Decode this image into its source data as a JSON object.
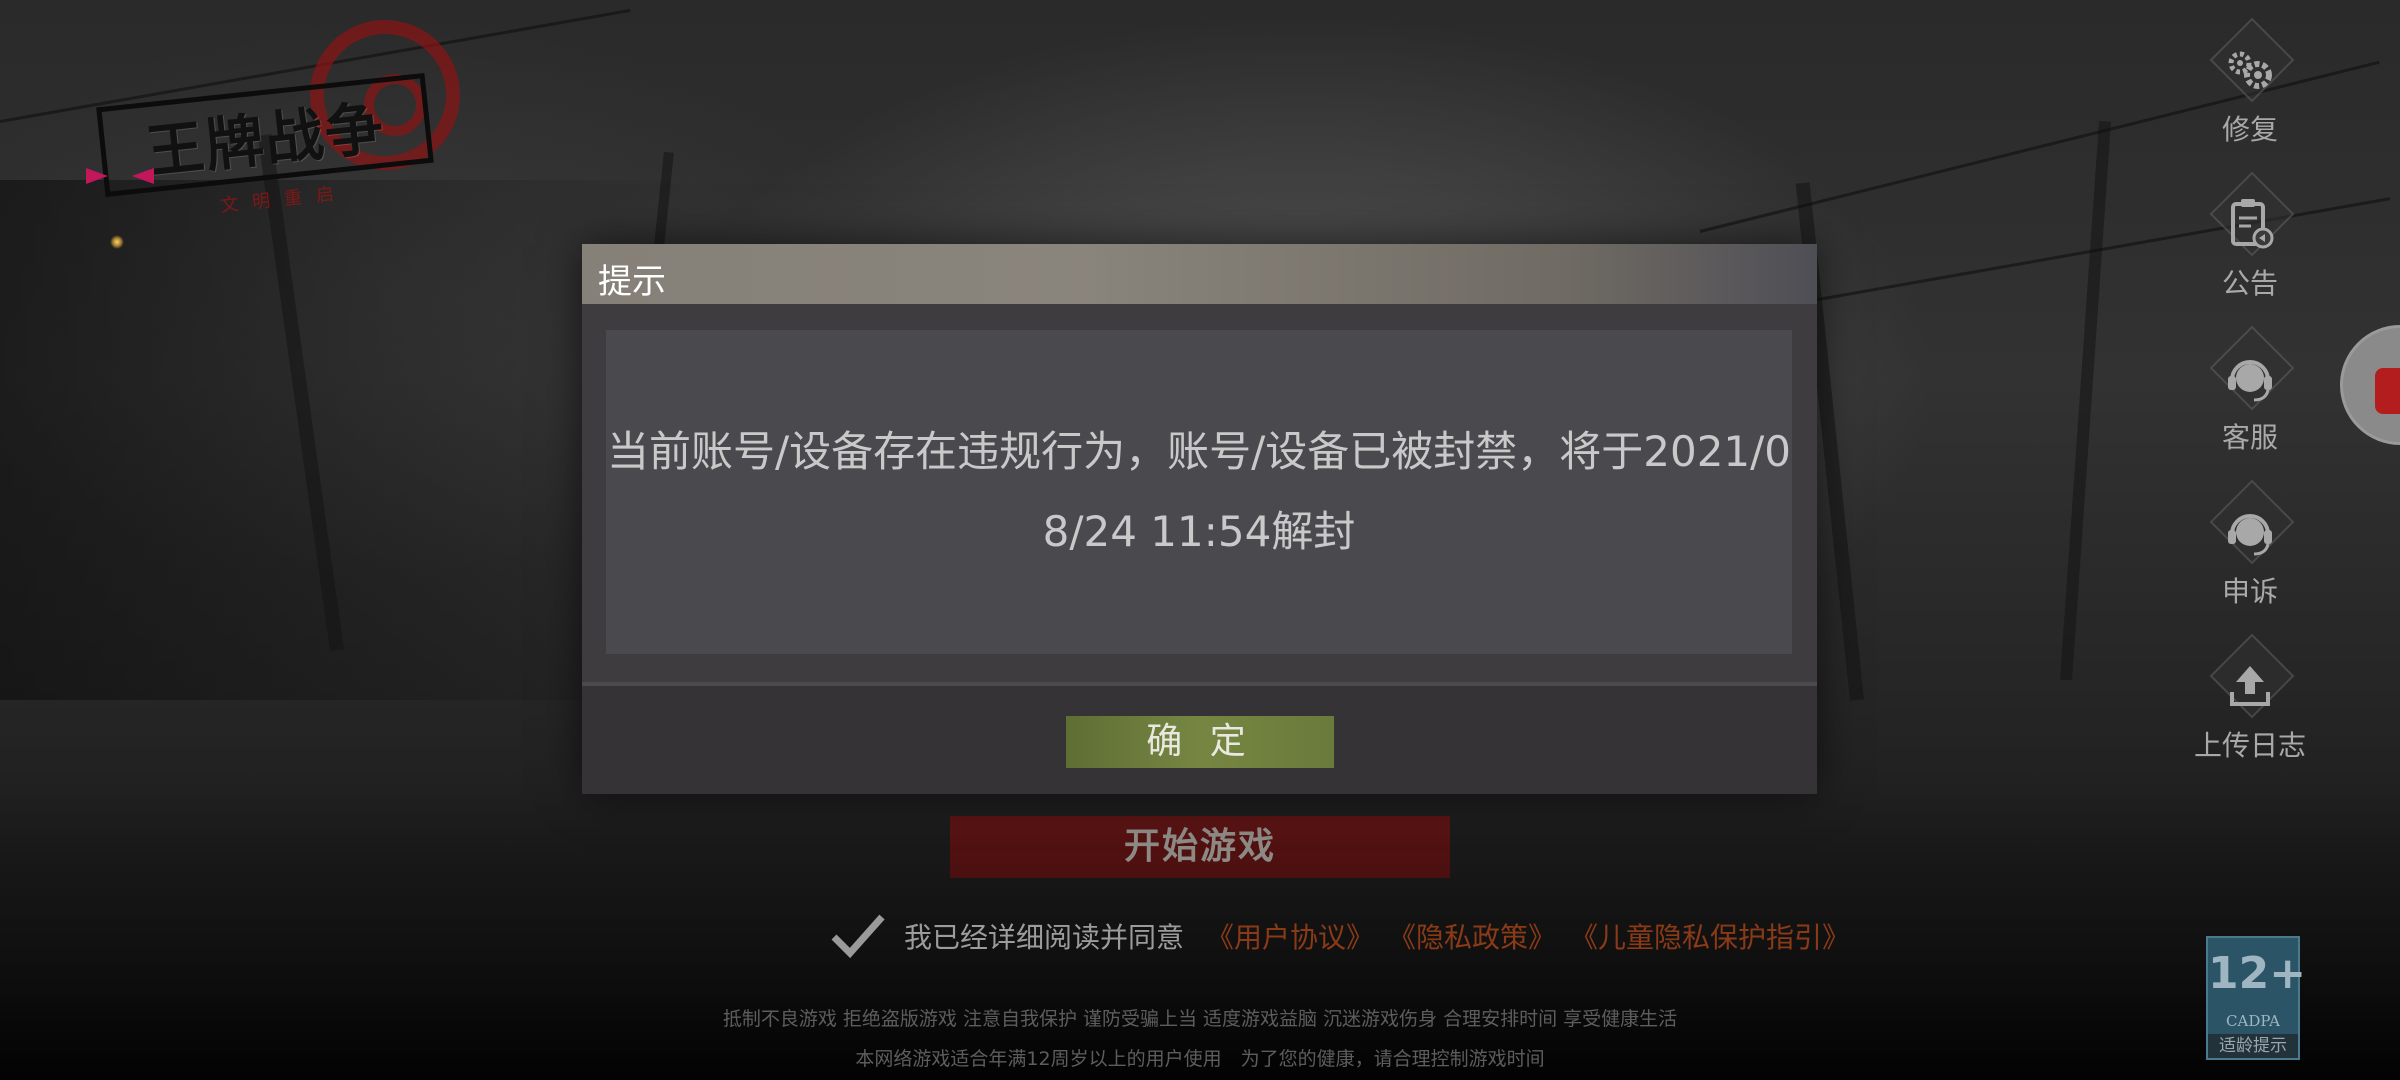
{
  "logo": {
    "title": "王牌战争",
    "subtitle": "文明重启"
  },
  "sidebar": {
    "items": [
      {
        "label": "修复",
        "icon": "gears-icon"
      },
      {
        "label": "公告",
        "icon": "notice-icon"
      },
      {
        "label": "客服",
        "icon": "headset-icon"
      },
      {
        "label": "申诉",
        "icon": "headset-icon"
      },
      {
        "label": "上传日志",
        "icon": "upload-icon"
      }
    ]
  },
  "main": {
    "start_button_label": "开始游戏"
  },
  "agreement": {
    "checked": true,
    "text": "我已经详细阅读并同意",
    "links": [
      "《用户协议》",
      "《隐私政策》",
      "《儿童隐私保护指引》"
    ]
  },
  "footer": {
    "line1": "抵制不良游戏 拒绝盗版游戏 注意自我保护 谨防受骗上当 适度游戏益脑 沉迷游戏伤身 合理安排时间 享受健康生活",
    "line2": "本网络游戏适合年满12周岁以上的用户使用　为了您的健康，请合理控制游戏时间"
  },
  "age_rating": {
    "rating": "12+",
    "org": "CADPA",
    "caption": "适龄提示"
  },
  "modal": {
    "title": "提示",
    "message": "当前账号/设备存在违规行为，账号/设备已被封禁，将于2021/08/24 11:54解封",
    "confirm_label": "确 定"
  },
  "colors": {
    "modal_bg": "#3e3c3e",
    "confirm_green": "#768642",
    "start_red": "#4a0f0f",
    "link_orange": "#8a3a16"
  }
}
